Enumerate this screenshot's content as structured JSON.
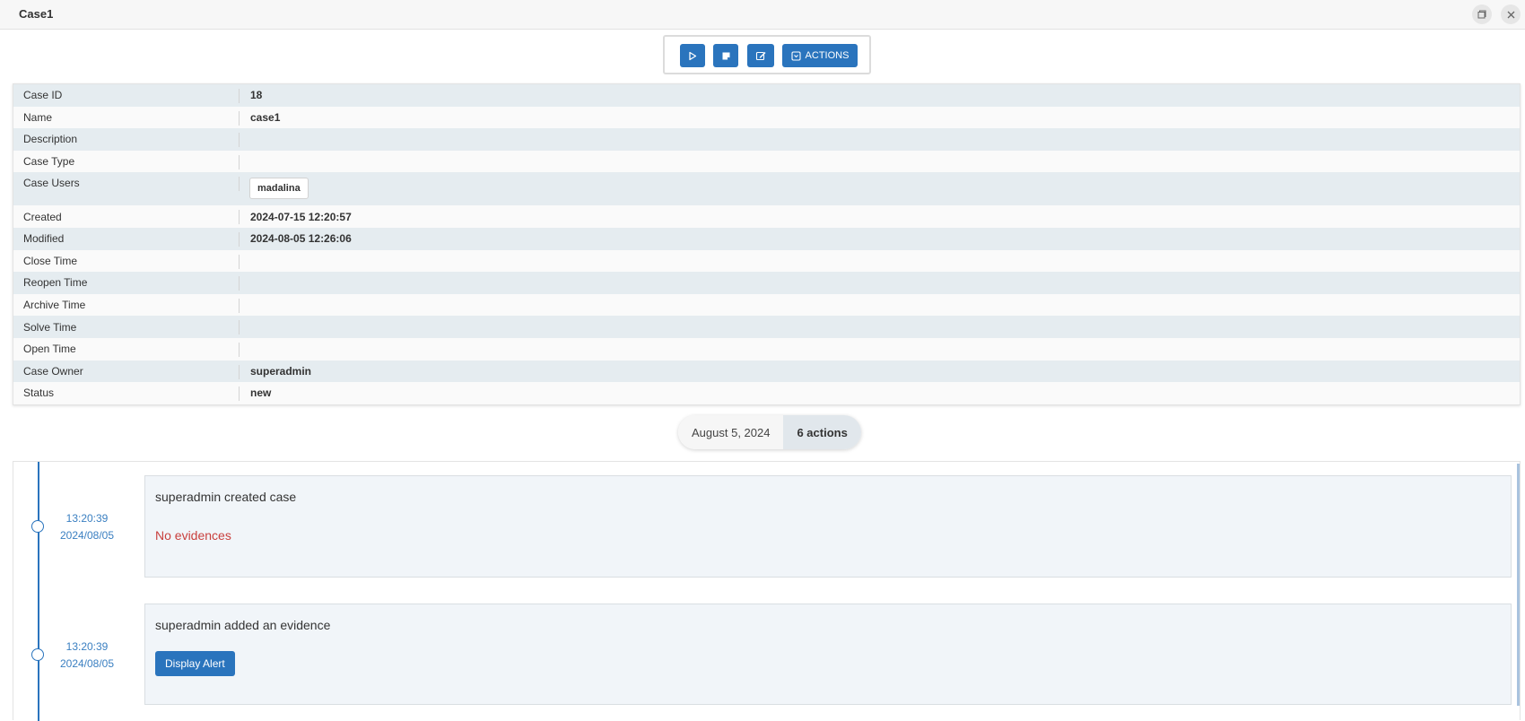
{
  "window": {
    "title": "Case1"
  },
  "toolbar": {
    "actions_label": "ACTIONS"
  },
  "details": {
    "rows": [
      {
        "label": "Case ID",
        "value": "18"
      },
      {
        "label": "Name",
        "value": "case1"
      },
      {
        "label": "Description",
        "value": ""
      },
      {
        "label": "Case Type",
        "value": ""
      },
      {
        "label": "Case Users",
        "value": "madalina"
      },
      {
        "label": "Created",
        "value": "2024-07-15 12:20:57"
      },
      {
        "label": "Modified",
        "value": "2024-08-05 12:26:06"
      },
      {
        "label": "Close Time",
        "value": ""
      },
      {
        "label": "Reopen Time",
        "value": ""
      },
      {
        "label": "Archive Time",
        "value": ""
      },
      {
        "label": "Solve Time",
        "value": ""
      },
      {
        "label": "Open Time",
        "value": ""
      },
      {
        "label": "Case Owner",
        "value": "superadmin"
      },
      {
        "label": "Status",
        "value": "new"
      }
    ]
  },
  "timeline": {
    "date": "August 5, 2024",
    "count": "6 actions",
    "events": [
      {
        "time": "13:20:39",
        "date": "2024/08/05",
        "text": "superadmin created case",
        "extra": "No evidences"
      },
      {
        "time": "13:20:39",
        "date": "2024/08/05",
        "text": "superadmin added an evidence",
        "button": "Display Alert"
      }
    ]
  },
  "colors": {
    "accent": "#2a74bd",
    "danger": "#c9403e"
  }
}
